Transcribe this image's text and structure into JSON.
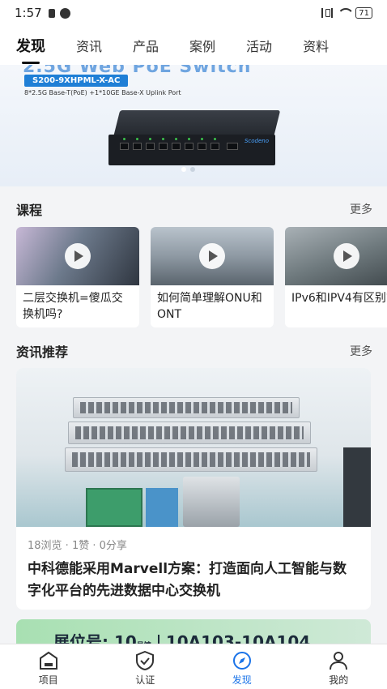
{
  "status_bar": {
    "time": "1:57",
    "battery": "71"
  },
  "top_tabs": [
    {
      "label": "发现",
      "active": true
    },
    {
      "label": "资讯",
      "active": false
    },
    {
      "label": "产品",
      "active": false
    },
    {
      "label": "案例",
      "active": false
    },
    {
      "label": "活动",
      "active": false
    },
    {
      "label": "资料",
      "active": false
    }
  ],
  "banner": {
    "title_partial": "2.5G Web PoE Switch",
    "model": "S200-9XHPML-X-AC",
    "spec": "8*2.5G Base-T(PoE) +1*10GE Base-X Uplink Port",
    "brand": "Scodeno"
  },
  "courses": {
    "title": "课程",
    "more": "更多",
    "items": [
      {
        "title": "二层交换机=傻瓜交换机吗?"
      },
      {
        "title": "如何简单理解ONU和ONT"
      },
      {
        "title": "IPv6和IPV4有区别?"
      }
    ]
  },
  "news": {
    "title": "资讯推荐",
    "more": "更多",
    "item": {
      "meta": "18浏览 · 1赞 · 0分享",
      "headline": "中科德能采用Marvell方案：打造面向人工智能与数字化平台的先进数据中心交换机"
    }
  },
  "promo": {
    "booth_label": "展位号: 10",
    "booth_sub": "号馆",
    "booth_range": "10A103-10A104"
  },
  "bottom_nav": [
    {
      "label": "项目",
      "icon": "project-icon",
      "active": false
    },
    {
      "label": "认证",
      "icon": "certification-icon",
      "active": false
    },
    {
      "label": "发现",
      "icon": "compass-icon",
      "active": true
    },
    {
      "label": "我的",
      "icon": "profile-icon",
      "active": false
    }
  ],
  "colors": {
    "accent": "#1a73e8",
    "tag_blue": "#1f7fd6"
  }
}
